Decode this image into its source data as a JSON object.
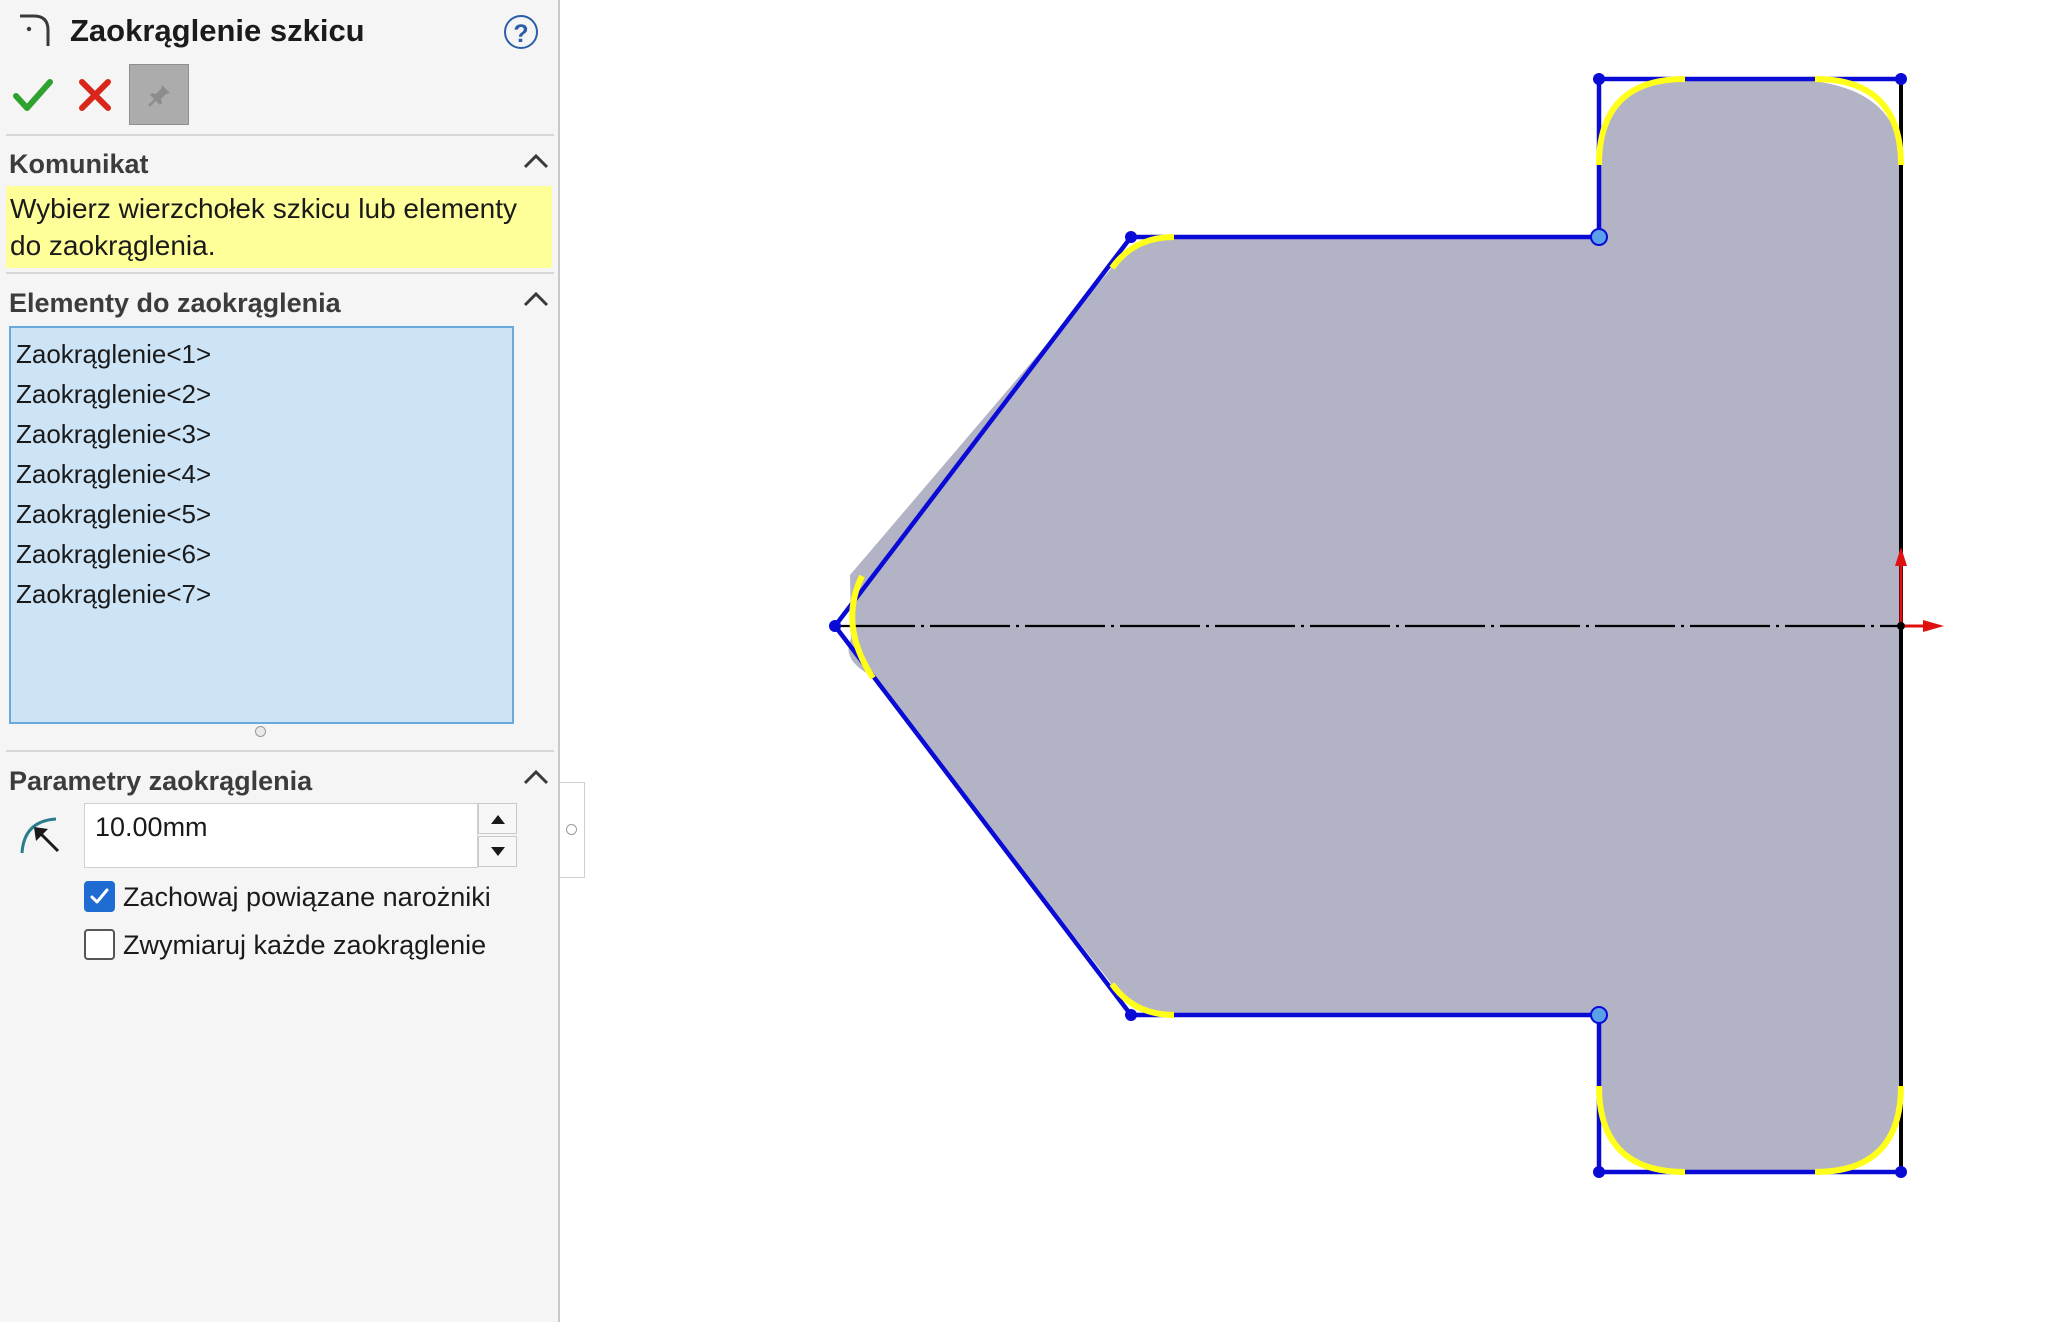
{
  "panel": {
    "title": "Zaokrąglenie szkicu",
    "help_symbol": "?",
    "title_icon": "sketch-fillet-icon",
    "buttons": [
      {
        "name": "ok",
        "icon": "green-checkmark-icon",
        "color": "#2fa12f"
      },
      {
        "name": "cancel",
        "icon": "red-x-icon",
        "color": "#d8261a"
      },
      {
        "name": "keep-visible",
        "icon": "pushpin-icon"
      }
    ]
  },
  "message": {
    "header": "Komunikat",
    "text": "Wybierz wierzchołek szkicu lub elementy do zaokrąglenia.",
    "background": "#ffff99"
  },
  "entities": {
    "header": "Elementy do zaokrąglenia",
    "items": [
      "Zaokrąglenie<1>",
      "Zaokrąglenie<2>",
      "Zaokrąglenie<3>",
      "Zaokrąglenie<4>",
      "Zaokrąglenie<5>",
      "Zaokrąglenie<6>",
      "Zaokrąglenie<7>"
    ],
    "list_background": "#cde4f6"
  },
  "parameters": {
    "header": "Parametry zaokrąglenia",
    "radius_icon": "fillet-radius-icon",
    "radius_value": "10.00mm",
    "keep_constrained_corners": {
      "label": "Zachowaj powiązane narożniki",
      "checked": true
    },
    "dimension_each_fillet": {
      "label": "Zwymiaruj każde zaokrąglenie",
      "checked": false
    }
  },
  "graphics": {
    "profile_fill": "#b3b3c6",
    "sketch_line_color": "#0a0ad6",
    "selected_fillet_color": "#ffff1a",
    "centerline_color": "#000000",
    "origin_axis_color": "#e01010",
    "constraint_point_color": "#5aa0ea"
  }
}
